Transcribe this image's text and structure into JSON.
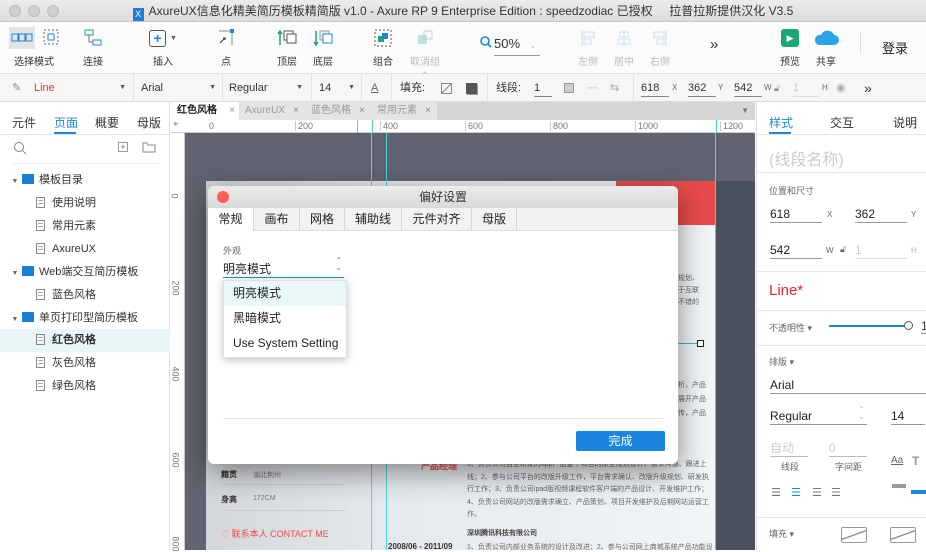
{
  "window": {
    "title": "AxureUX信息化精美简历模板精简版 v1.0 - Axure RP 9 Enterprise Edition : speedzodiac 已授权     拉普拉斯提供汉化 V3.5"
  },
  "toolbar": {
    "select_mode": "选择模式",
    "connect": "连接",
    "insert": "插入",
    "point": "点",
    "top": "顶层",
    "bottom": "底层",
    "group": "组合",
    "ungroup": "取消组合",
    "zoom": "50%",
    "align_left": "左侧",
    "align_center": "居中",
    "align_right": "右侧",
    "more": "»",
    "preview": "预览",
    "share": "共享",
    "login": "登录",
    "preview_color": "#1aa870",
    "share_color": "#2aa3ea"
  },
  "formatbar": {
    "style": "Line",
    "font": "Arial",
    "weight": "Regular",
    "size": "14",
    "fill_label": "填充:",
    "stroke_label": "线段:",
    "stroke_width": "1",
    "x": "618",
    "x_label": "X",
    "y": "362",
    "y_label": "Y",
    "w": "542",
    "w_label": "W",
    "h": "1",
    "h_label": "H",
    "more": "»"
  },
  "leftpanel": {
    "tabs": [
      "元件",
      "页面",
      "概要",
      "母版"
    ],
    "active_tab": "页面",
    "tree": [
      {
        "type": "folder",
        "label": "模板目录"
      },
      {
        "type": "page",
        "label": "使用说明"
      },
      {
        "type": "page",
        "label": "常用元素"
      },
      {
        "type": "page",
        "label": "AxureUX"
      },
      {
        "type": "folder",
        "label": "Web端交互简历模板"
      },
      {
        "type": "page",
        "label": "蓝色风格"
      },
      {
        "type": "folder",
        "label": "单页打印型简历模板"
      },
      {
        "type": "page",
        "label": "红色风格",
        "selected": true
      },
      {
        "type": "page",
        "label": "灰色风格"
      },
      {
        "type": "page",
        "label": "绿色风格"
      }
    ]
  },
  "doc_tabs": [
    {
      "label": "红色风格",
      "active": true
    },
    {
      "label": "AxureUX"
    },
    {
      "label": "蓝色风格"
    },
    {
      "label": "常用元素"
    }
  ],
  "ruler": {
    "h_ticks": [
      "0",
      "200",
      "400",
      "600",
      "800",
      "1000",
      "1200"
    ],
    "v_ticks": [
      "0",
      "200",
      "400",
      "600",
      "800"
    ]
  },
  "canvas_content": {
    "resume_left": [
      {
        "label": "籍贯",
        "value": "湖北荆州"
      },
      {
        "label": "身高",
        "value": "172CM"
      }
    ],
    "contact": "联系本人 CONTACT ME",
    "job_title": "产品经理",
    "job_desc": "1、负责公司自主研发的app产品整个项目的原型规划设计、需求沟通、跟进上线；2、参与公司平台的改版升级工作，平台需求确认、改版升级规划、研发执行工作；3、负责公司ipad版视频课程软件客户端的产品设计、开发维护工作；4、负责公司网站的改版需求确立、产品策划、项目开发维护及后期网站运营工作。",
    "company": "深圳腾讯科技有限公司",
    "period": "2008/06 - 2011/09",
    "desc2": "1、负责公司内部业务系统的设计及改进；2、参与公司网上商城系统产品功能设",
    "partial_right": [
      "规划、",
      "于互联",
      "不错的",
      "析，产品",
      "展开产品",
      "传，产品"
    ],
    "accent": "#e94b4b"
  },
  "dialog": {
    "title": "偏好设置",
    "tabs": [
      "常规",
      "画布",
      "网格",
      "辅助线",
      "元件对齐",
      "母版"
    ],
    "active_tab": "常规",
    "section_label": "外观",
    "appearance_value": "明亮模式",
    "options": [
      "明亮模式",
      "黑暗模式",
      "Use System Setting"
    ],
    "highlighted_option": "明亮模式",
    "done": "完成"
  },
  "rightpanel": {
    "tabs": [
      "样式",
      "交互",
      "说明"
    ],
    "active_tab": "样式",
    "name_placeholder": "(线段名称)",
    "pos_size_label": "位置和尺寸",
    "x": "618",
    "x_label": "X",
    "y": "362",
    "y_label": "Y",
    "w": "542",
    "w_label": "W",
    "h": "1",
    "h_label": "H",
    "style_name": "Line*",
    "opacity_label": "不透明性 ▾",
    "opacity_value": "1",
    "opacity": 1.0,
    "typography_label": "排版 ▾",
    "font": "Arial",
    "weight": "Regular",
    "size": "14",
    "line_spacing": "自动",
    "line_spacing_label": "线段",
    "char_spacing": "0",
    "char_spacing_label": "字间距",
    "fill_label": "填充 ▾"
  }
}
